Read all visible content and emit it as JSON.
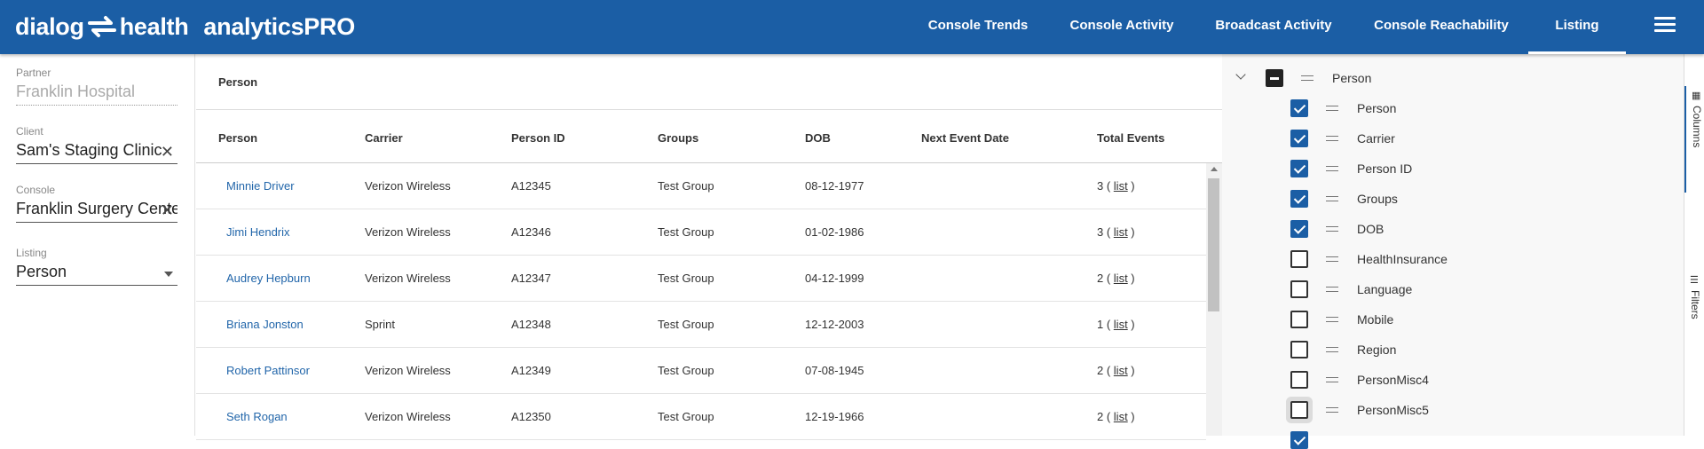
{
  "header": {
    "logo": {
      "left": "dialog",
      "right": "health",
      "product": "analyticsPRO"
    },
    "nav": [
      {
        "label": "Console Trends"
      },
      {
        "label": "Console Activity"
      },
      {
        "label": "Broadcast Activity"
      },
      {
        "label": "Console Reachability"
      },
      {
        "label": "Listing",
        "active": true
      }
    ],
    "menu_icon": "hamburger-menu-icon"
  },
  "filters": {
    "partner": {
      "label": "Partner",
      "value": "Franklin Hospital"
    },
    "client": {
      "label": "Client",
      "value": "Sam's Staging Clinic"
    },
    "console": {
      "label": "Console",
      "value": "Franklin Surgery Center"
    },
    "listing": {
      "label": "Listing",
      "value": "Person"
    }
  },
  "grid": {
    "title": "Person",
    "columns": [
      "Person",
      "Carrier",
      "Person ID",
      "Groups",
      "DOB",
      "Next Event Date",
      "Total Events"
    ],
    "rows": [
      {
        "person": "Minnie Driver",
        "carrier": "Verizon Wireless",
        "id": "A12345",
        "groups": "Test Group",
        "dob": "08-12-1977",
        "next": "",
        "total": "3",
        "list": "list"
      },
      {
        "person": "Jimi Hendrix",
        "carrier": "Verizon Wireless",
        "id": "A12346",
        "groups": "Test Group",
        "dob": "01-02-1986",
        "next": "",
        "total": "3",
        "list": "list"
      },
      {
        "person": "Audrey Hepburn",
        "carrier": "Verizon Wireless",
        "id": "A12347",
        "groups": "Test Group",
        "dob": "04-12-1999",
        "next": "",
        "total": "2",
        "list": "list"
      },
      {
        "person": "Briana Jonston",
        "carrier": "Sprint",
        "id": "A12348",
        "groups": "Test Group",
        "dob": "12-12-2003",
        "next": "",
        "total": "1",
        "list": "list"
      },
      {
        "person": "Robert Pattinsor",
        "carrier": "Verizon Wireless",
        "id": "A12349",
        "groups": "Test Group",
        "dob": "07-08-1945",
        "next": "",
        "total": "2",
        "list": "list"
      },
      {
        "person": "Seth Rogan",
        "carrier": "Verizon Wireless",
        "id": "A12350",
        "groups": "Test Group",
        "dob": "12-19-1966",
        "next": "",
        "total": "2",
        "list": "list"
      }
    ]
  },
  "columns_panel": {
    "group": {
      "label": "Person",
      "state": "indeterminate"
    },
    "items": [
      {
        "label": "Person",
        "checked": true
      },
      {
        "label": "Carrier",
        "checked": true
      },
      {
        "label": "Person ID",
        "checked": true
      },
      {
        "label": "Groups",
        "checked": true
      },
      {
        "label": "DOB",
        "checked": true
      },
      {
        "label": "HealthInsurance",
        "checked": false
      },
      {
        "label": "Language",
        "checked": false
      },
      {
        "label": "Mobile",
        "checked": false
      },
      {
        "label": "Region",
        "checked": false
      },
      {
        "label": "PersonMisc4",
        "checked": false
      },
      {
        "label": "PersonMisc5",
        "checked": false
      }
    ]
  },
  "side_tabs": [
    {
      "label": "Columns",
      "active": true
    },
    {
      "label": "Filters",
      "active": false
    }
  ],
  "colors": {
    "brand": "#1b5ea5",
    "link": "#2266aa"
  }
}
